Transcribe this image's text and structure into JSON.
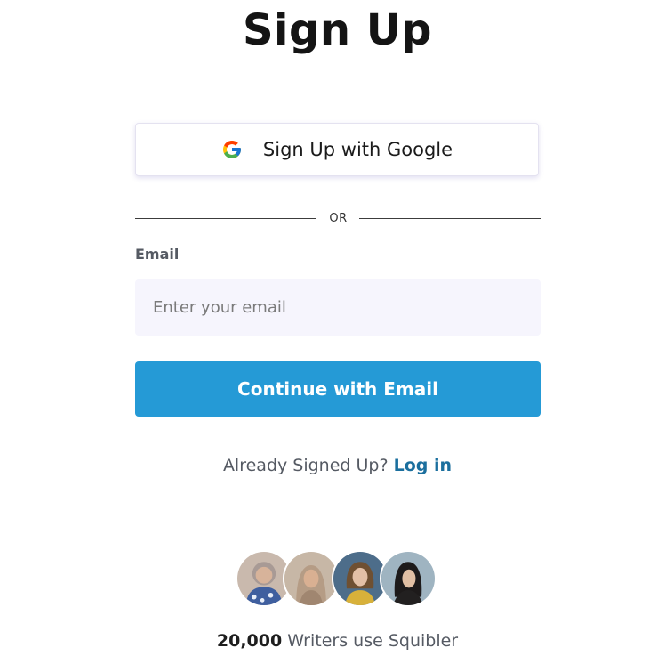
{
  "page": {
    "title": "Sign Up"
  },
  "google": {
    "button_label": "Sign Up with Google",
    "icon": "google-g-logo"
  },
  "divider": {
    "label": "OR"
  },
  "email": {
    "label": "Email",
    "placeholder": "Enter your email",
    "value": ""
  },
  "continue": {
    "label": "Continue with Email"
  },
  "login_prompt": {
    "text": "Already Signed Up?",
    "link_label": "Log in"
  },
  "social_proof": {
    "avatars": [
      "avatar-writer-1",
      "avatar-writer-2",
      "avatar-writer-3",
      "avatar-writer-4"
    ],
    "count": "20,000",
    "text": "Writers use Squibler"
  },
  "colors": {
    "primary_button": "#259ad6",
    "link": "#1b6f9e",
    "input_background": "#f6f5fd",
    "muted_text": "#555a63"
  }
}
